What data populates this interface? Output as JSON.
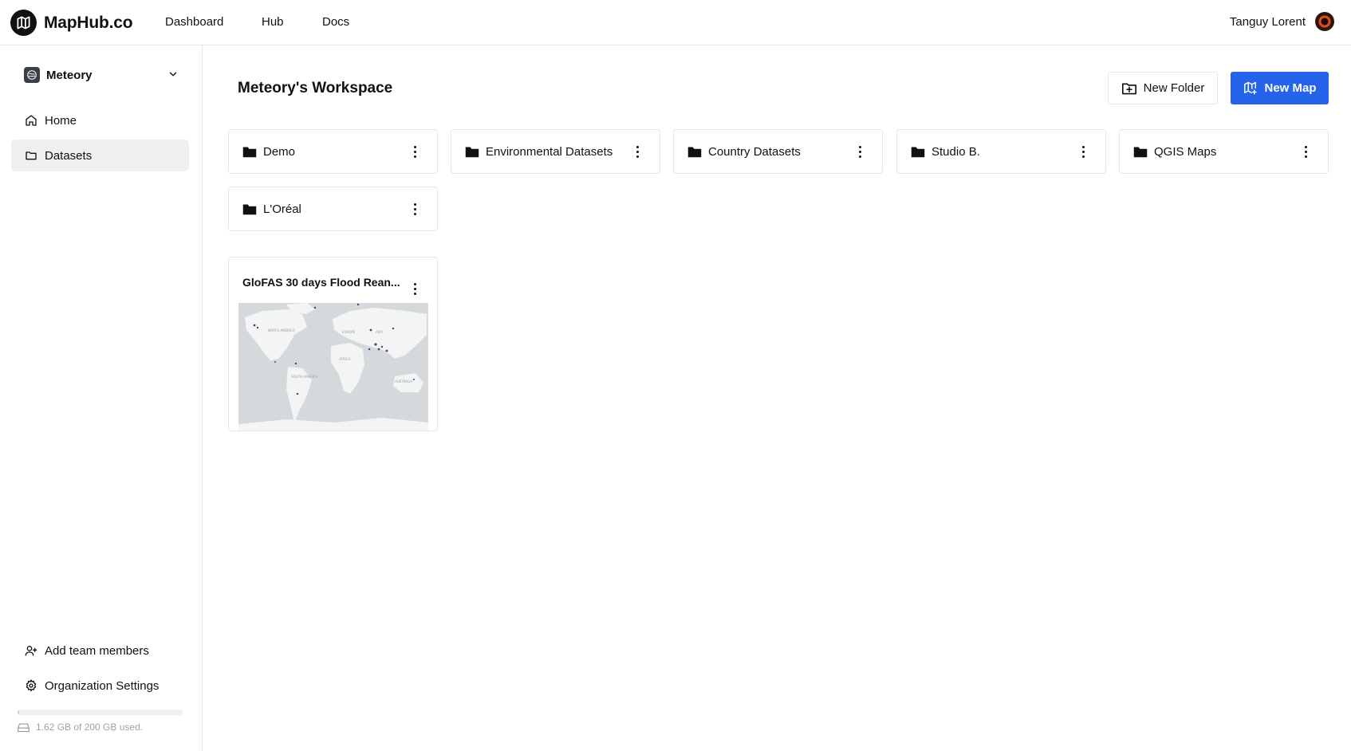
{
  "app": {
    "name": "MapHub.co"
  },
  "nav": {
    "items": [
      "Dashboard",
      "Hub",
      "Docs"
    ]
  },
  "user": {
    "name": "Tanguy Lorent"
  },
  "sidebar": {
    "org_name": "Meteory",
    "items": [
      {
        "label": "Home",
        "icon": "home-icon",
        "active": false
      },
      {
        "label": "Datasets",
        "icon": "folder-outline-icon",
        "active": true
      }
    ],
    "bottom_items": [
      {
        "label": "Add team members",
        "icon": "user-plus-icon"
      },
      {
        "label": "Organization Settings",
        "icon": "gear-icon"
      }
    ],
    "storage": {
      "text": "1.62 GB of 200 GB used.",
      "used_fraction": 0.0081
    }
  },
  "main": {
    "title": "Meteory's Workspace",
    "new_folder_label": "New Folder",
    "new_map_label": "New Map",
    "folders": [
      "Demo",
      "Environmental Datasets",
      "Country Datasets",
      "Studio B.",
      "QGIS Maps",
      "L'Oréal"
    ],
    "maps": [
      {
        "title": "GloFAS 30 days Flood Rean...",
        "thumb_labels": [
          "NORTH AMERICA",
          "EUROPE",
          "ASIA",
          "AFRICA",
          "SOUTH AMERICA",
          "AUSTRALIA"
        ]
      }
    ]
  },
  "colors": {
    "accent": "#2563eb",
    "active_bg": "#eeeff1",
    "border": "#e5e7eb"
  }
}
